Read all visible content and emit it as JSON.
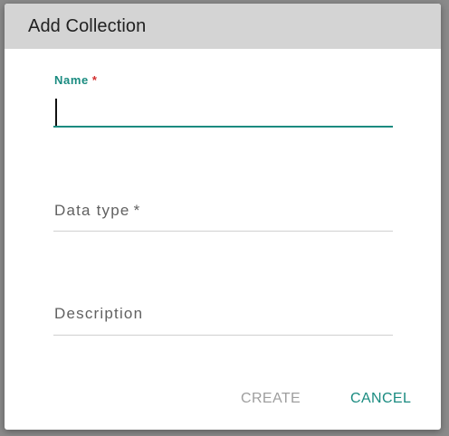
{
  "dialog": {
    "title": "Add Collection",
    "fields": {
      "name": {
        "label": "Name",
        "required_mark": "*",
        "value": ""
      },
      "data_type": {
        "label": "Data type",
        "required_mark": "*"
      },
      "description": {
        "label": "Description"
      }
    },
    "actions": {
      "create_label": "CREATE",
      "cancel_label": "CANCEL"
    }
  },
  "colors": {
    "accent": "#1a8b80",
    "required": "#d32f2f",
    "disabled_text": "#9e9e9e",
    "header_bg": "#d4d4d4"
  }
}
